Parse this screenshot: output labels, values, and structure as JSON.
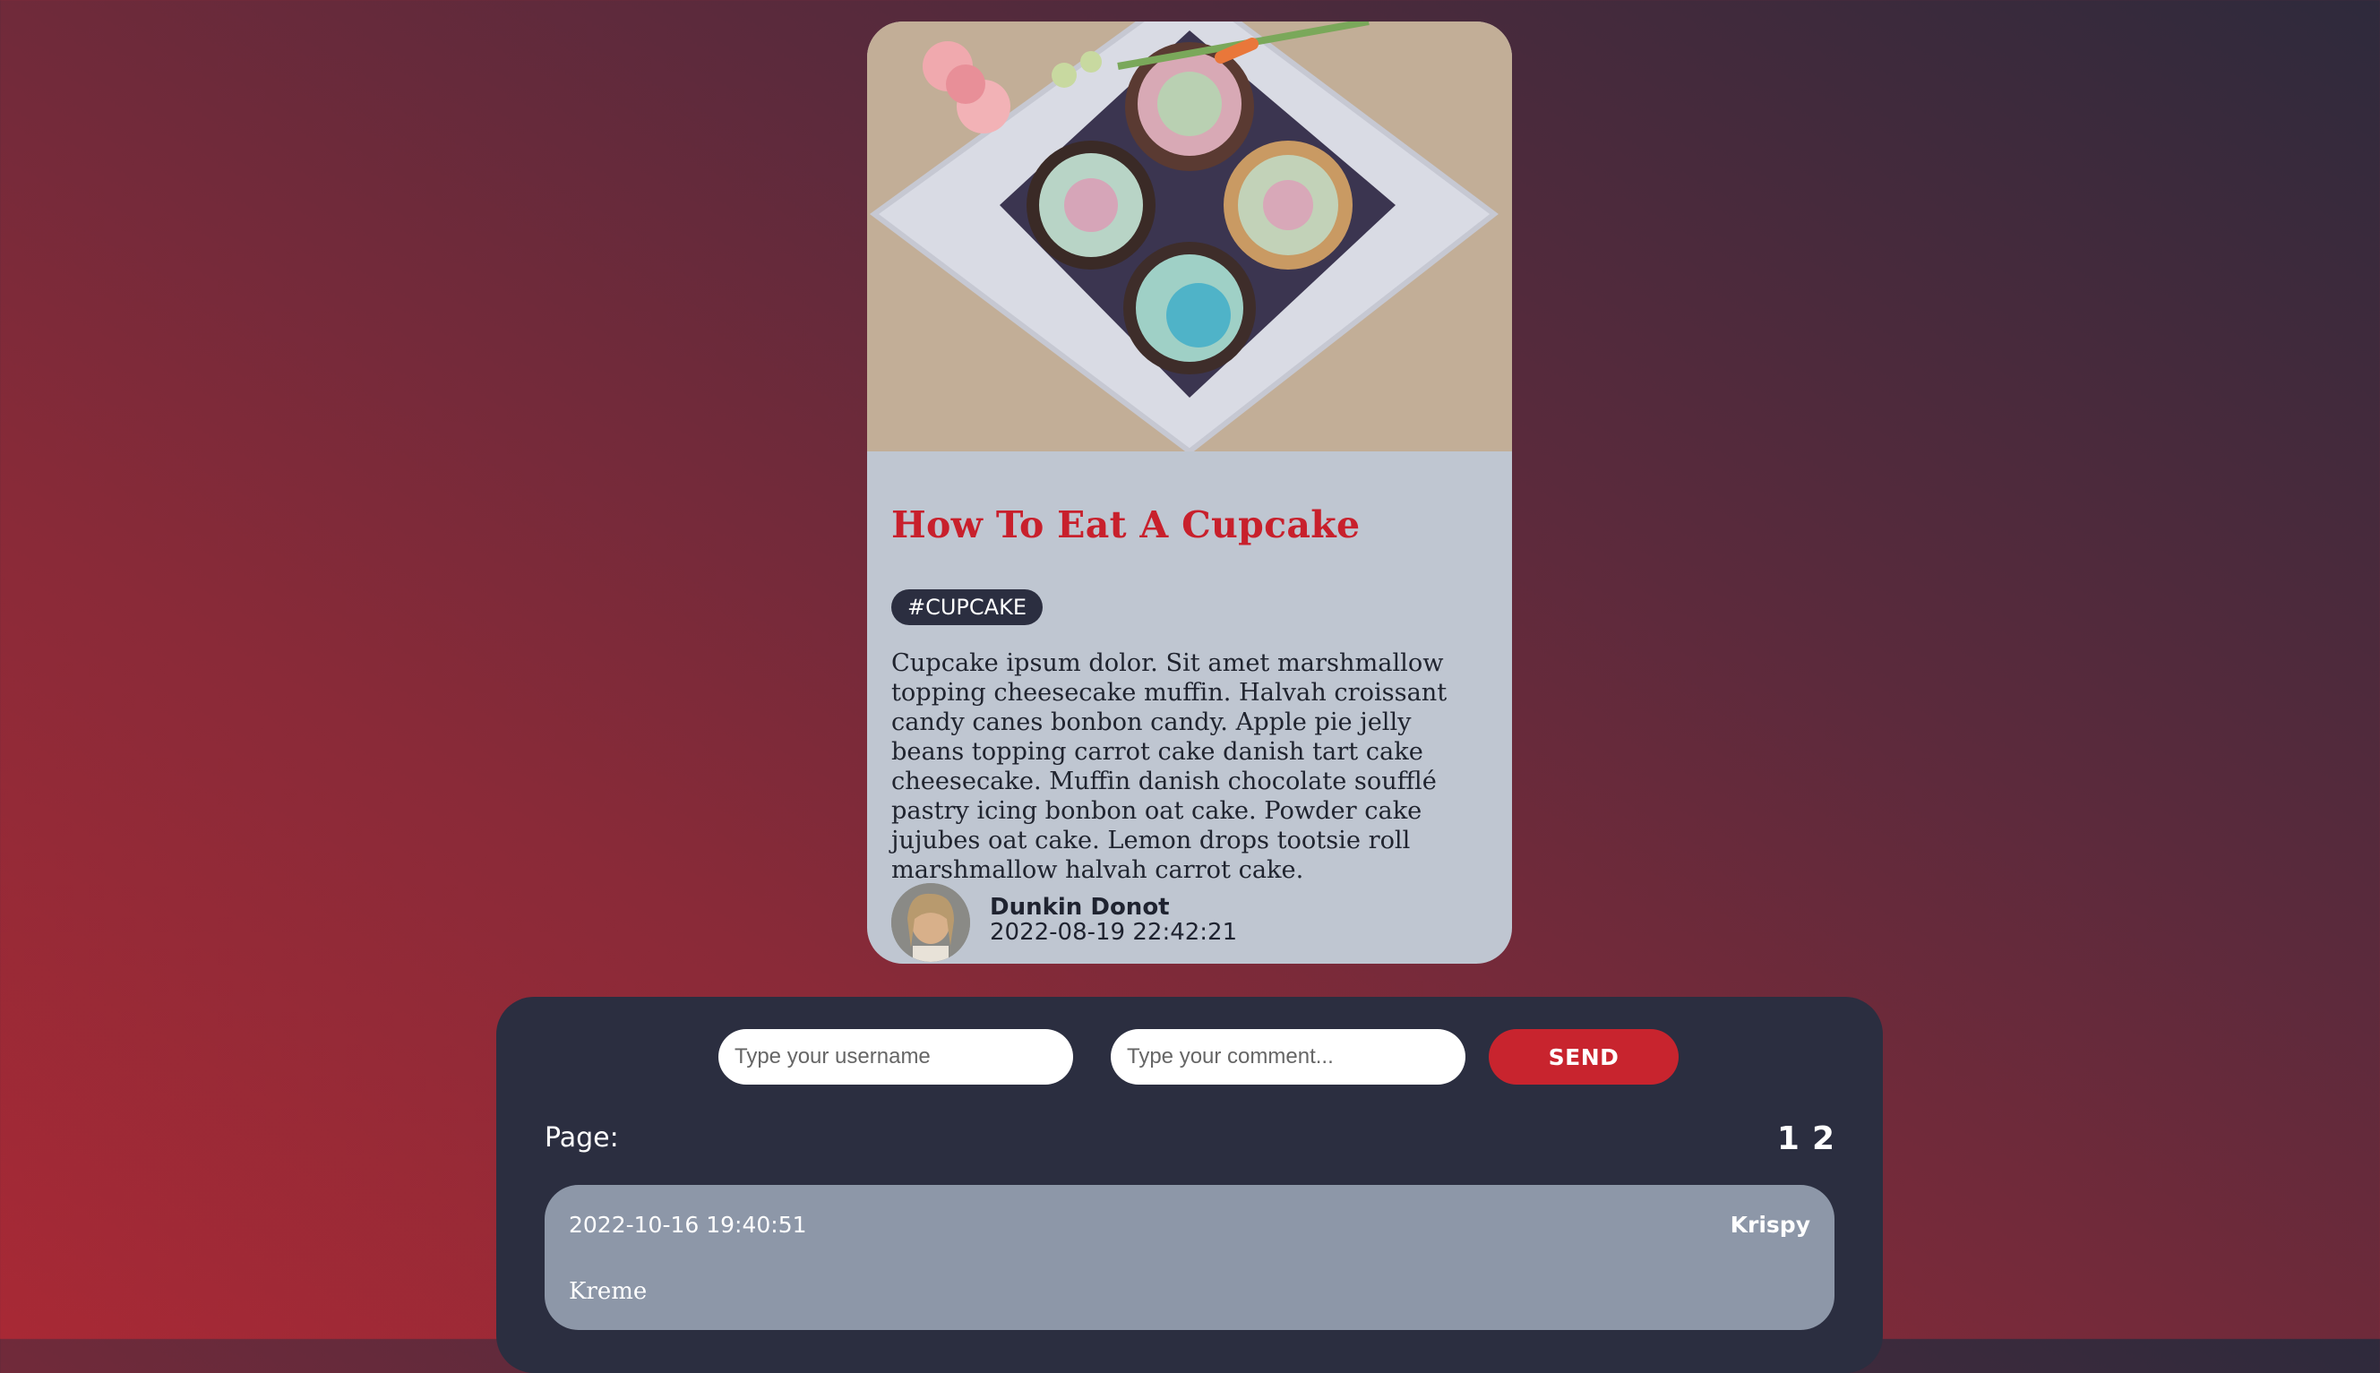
{
  "post": {
    "title": "How To Eat A Cupcake",
    "tag": "#CUPCAKE",
    "body": "Cupcake ipsum dolor. Sit amet marshmallow topping cheesecake muffin. Halvah croissant candy canes bonbon candy. Apple pie jelly beans topping carrot cake danish tart cake cheesecake. Muffin danish chocolate soufflé pastry icing bonbon oat cake. Powder cake jujubes oat cake. Lemon drops tootsie roll marshmallow halvah carrot cake.",
    "author": {
      "name": "Dunkin Donot",
      "date": "2022-08-19 22:42:21"
    }
  },
  "comment_form": {
    "username_placeholder": "Type your username",
    "comment_placeholder": "Type your comment...",
    "send_label": "SEND"
  },
  "pagination": {
    "label": "Page:",
    "pages": [
      "1",
      "2"
    ]
  },
  "comments": [
    {
      "date": "2022-10-16 19:40:51",
      "username": "Krispy",
      "text": "Kreme"
    }
  ],
  "colors": {
    "accent": "#c8202c",
    "dark_panel": "#2b2e40",
    "card_bg": "#bfc6d1",
    "comment_bg": "#8d97a8"
  }
}
